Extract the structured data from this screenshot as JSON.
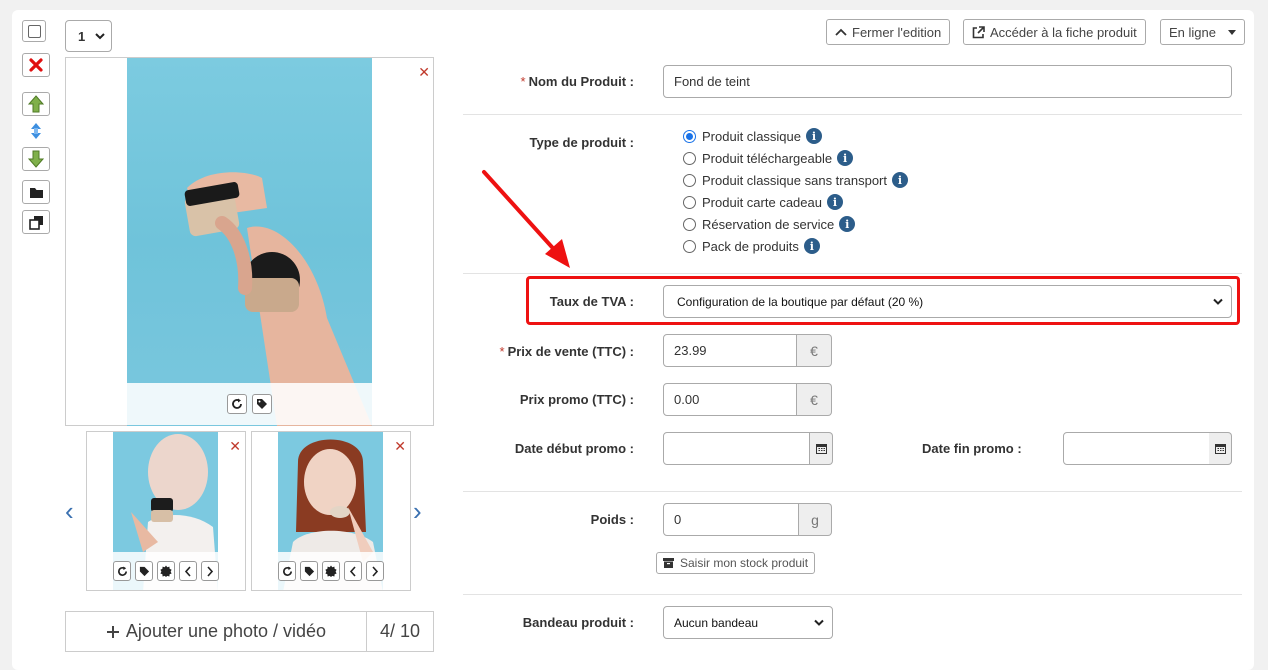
{
  "toolbar": {
    "qty_value": "1",
    "edit_close_label": "Fermer l'edition",
    "product_sheet_label": "Accéder à la fiche produit",
    "status_label": "En ligne"
  },
  "photos": {
    "add_label": "Ajouter une photo / vidéo",
    "count": "4/ 10"
  },
  "form": {
    "name_label": "Nom du Produit :",
    "name_value": "Fond de teint",
    "type_label": "Type de produit :",
    "types": [
      {
        "label": "Produit classique",
        "selected": true
      },
      {
        "label": "Produit téléchargeable",
        "selected": false
      },
      {
        "label": "Produit classique sans transport",
        "selected": false
      },
      {
        "label": "Produit carte cadeau",
        "selected": false
      },
      {
        "label": "Réservation de service",
        "selected": false
      },
      {
        "label": "Pack de produits",
        "selected": false
      }
    ],
    "vat_label": "Taux de TVA :",
    "vat_value": "Configuration de la boutique par défaut (20 %)",
    "price_label": "Prix de vente (TTC) :",
    "price_value": "23.99",
    "currency": "€",
    "promo_price_label": "Prix promo (TTC) :",
    "promo_price_value": "0.00",
    "promo_start_label": "Date début promo :",
    "promo_end_label": "Date fin promo :",
    "weight_label": "Poids :",
    "weight_value": "0",
    "weight_unit": "g",
    "stock_label": "Saisir mon stock produit",
    "banner_label": "Bandeau produit :",
    "banner_value": "Aucun bandeau"
  },
  "colors": {
    "accent_red": "#e11111",
    "info_blue": "#2c5d8a",
    "radio_blue": "#1a73e8"
  }
}
